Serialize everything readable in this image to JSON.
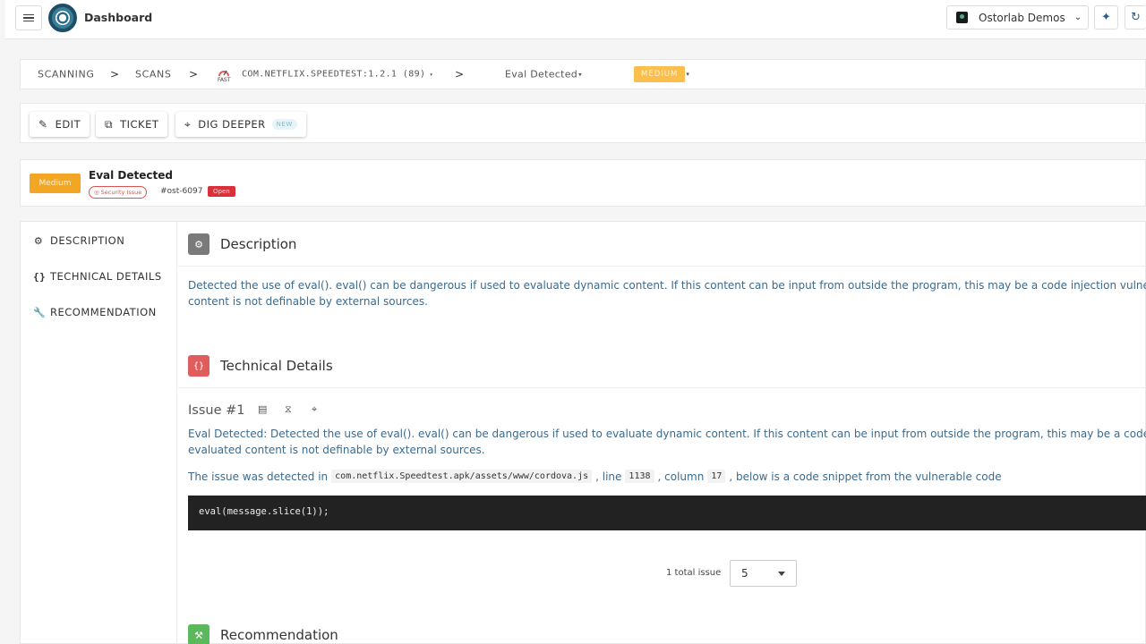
{
  "header": {
    "title": "Dashboard",
    "org_name": "Ostorlab Demos"
  },
  "breadcrumb": {
    "scanning": "SCANNING",
    "scans": "SCANS",
    "scan_label": "COM.NETFLIX.SPEEDTEST:1.2.1 (89)",
    "fast_label": "FAST",
    "vuln_label": "Eval Detected",
    "severity": "MEDIUM",
    "separator": ">"
  },
  "toolbar": {
    "edit": "EDIT",
    "ticket": "TICKET",
    "dig_deeper": "DIG DEEPER",
    "new_badge": "NEW"
  },
  "vulnerability": {
    "severity": "Medium",
    "title": "Eval Detected",
    "category": "Security Issue",
    "id": "#ost-6097",
    "status": "Open"
  },
  "sidebar": {
    "items": [
      {
        "label": "DESCRIPTION"
      },
      {
        "label": "TECHNICAL DETAILS"
      },
      {
        "label": "RECOMMENDATION"
      }
    ]
  },
  "description": {
    "title": "Description",
    "line1": "Detected the use of eval(). eval() can be dangerous if used to evaluate dynamic content. If this content can be input from outside the program, this may be a code injection vulnerability. E",
    "line2": "content is not definable by external sources."
  },
  "technical": {
    "title": "Technical Details",
    "issue_title": "Issue #1",
    "line1": "Eval Detected: Detected the use of eval(). eval() can be dangerous if used to evaluate dynamic content. If this content can be input from outside the program, this may be a code injection",
    "line2": "evaluated content is not definable by external sources.",
    "detect_prefix": "The issue was detected in",
    "file": "com.netflix.Speedtest.apk/assets/www/cordova.js",
    "line_word": ", line",
    "line_no": "1138",
    "column_word": ", column",
    "column_no": "17",
    "detect_suffix": ", below is a code snippet from the vulnerable code",
    "code": "eval(message.slice(1));",
    "total_issues": "1 total issue",
    "page_size": "5"
  },
  "recommendation": {
    "title": "Recommendation"
  },
  "colors": {
    "medium": "#f3a623",
    "open": "#d9303a",
    "description_icon": "#7a7a7a",
    "technical_icon": "#e05d5d",
    "recommendation_icon": "#5cb85c"
  }
}
